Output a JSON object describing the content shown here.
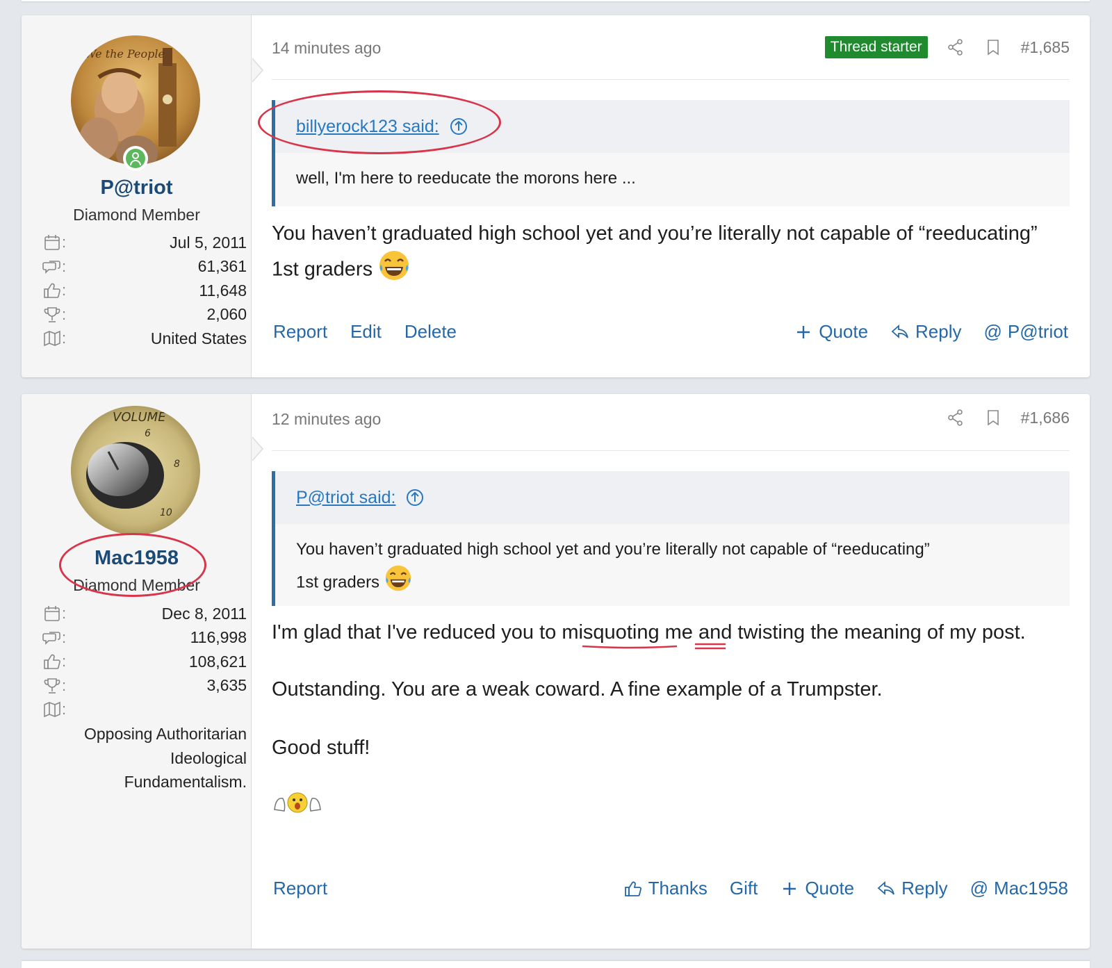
{
  "colors": {
    "accent_link": "#2568a8",
    "username": "#1b4a77",
    "thread_starter_badge": "#1f8a2e",
    "quote_border": "#2f6ea5",
    "annotation_red": "#d8344a"
  },
  "posts": [
    {
      "time": "14 minutes ago",
      "badge": "Thread starter",
      "post_number": "#1,685",
      "user": {
        "name": "P@triot",
        "title": "Diamond Member",
        "online": true,
        "stats": [
          {
            "icon": "calendar-icon",
            "label": ":",
            "value": "Jul 5, 2011"
          },
          {
            "icon": "messages-icon",
            "label": ":",
            "value": "61,361"
          },
          {
            "icon": "thumbs-up-icon",
            "label": ":",
            "value": "11,648"
          },
          {
            "icon": "trophy-icon",
            "label": ":",
            "value": "2,060"
          },
          {
            "icon": "map-icon",
            "label": ":",
            "value": "United States"
          }
        ]
      },
      "quote": {
        "author": "billyerock123 said:",
        "text": "well, I'm here to reeducate the morons here ..."
      },
      "body": [
        "You haven’t graduated high school yet and you’re literally not capable of “reeducating” 1st graders"
      ],
      "actions_left": [
        "Report",
        "Edit",
        "Delete"
      ],
      "actions_right": [
        "Quote",
        "Reply",
        "P@triot"
      ]
    },
    {
      "time": "12 minutes ago",
      "post_number": "#1,686",
      "user": {
        "name": "Mac1958",
        "title": "Diamond Member",
        "stats": [
          {
            "icon": "calendar-icon",
            "label": ":",
            "value": "Dec 8, 2011"
          },
          {
            "icon": "messages-icon",
            "label": ":",
            "value": "116,998"
          },
          {
            "icon": "thumbs-up-icon",
            "label": ":",
            "value": "108,621"
          },
          {
            "icon": "trophy-icon",
            "label": ":",
            "value": "3,635"
          },
          {
            "icon": "map-icon",
            "label": ":",
            "value": ""
          }
        ],
        "location": [
          "Opposing Authoritarian",
          "Ideological",
          "Fundamentalism."
        ]
      },
      "quote": {
        "author": "P@triot said:",
        "text_line1": "You haven’t graduated high school yet and you’re literally not capable of “reeducating”",
        "text_line2": "1st graders"
      },
      "body": {
        "p1_pre": "I'm glad that I've reduced you to ",
        "p1_w1": "misquoting",
        "p1_mid": " ",
        "p1_w2": "me",
        "p1_post": " and twisting the meaning of my post.",
        "p2": "Outstanding. You are a weak coward. A fine example of a Trumpster.",
        "p3": "Good stuff!"
      },
      "actions_left": [
        "Report"
      ],
      "actions_right": [
        "Thanks",
        "Gift",
        "Quote",
        "Reply",
        "Mac1958"
      ]
    }
  ]
}
